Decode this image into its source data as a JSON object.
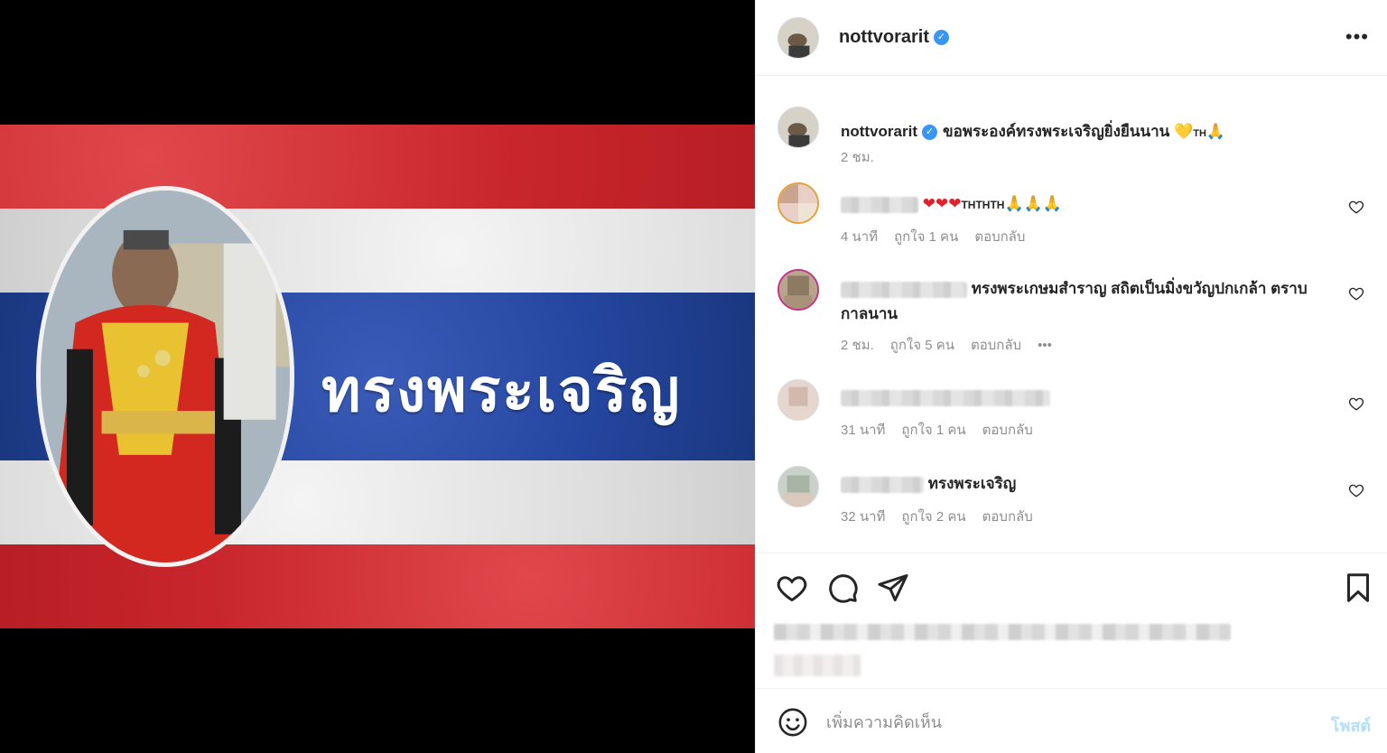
{
  "post": {
    "username": "nottvorarit",
    "headline_text": "ทรงพระเจริญ",
    "caption": "ขอพระองค์ทรงพระเจริญยิ่งยืนนาน",
    "caption_emoji": "💛",
    "caption_flag": "TH",
    "caption_pray": "🙏",
    "caption_time": "2 ชม."
  },
  "comments": [
    {
      "text_emoji": "❤❤❤",
      "flags": "THTHTH",
      "pray": "🙏🙏🙏",
      "time": "4 นาที",
      "likes": "ถูกใจ 1 คน",
      "reply": "ตอบกลับ"
    },
    {
      "text": "ทรงพระเกษมสำราญ สถิตเป็นมิ่งขวัญปกเกล้า ตราบกาลนาน",
      "time": "2 ชม.",
      "likes": "ถูกใจ 5 คน",
      "reply": "ตอบกลับ",
      "more": "•••"
    },
    {
      "time": "31 นาที",
      "likes": "ถูกใจ 1 คน",
      "reply": "ตอบกลับ"
    },
    {
      "text": "ทรงพระเจริญ",
      "time": "32 นาที",
      "likes": "ถูกใจ 2 คน",
      "reply": "ตอบกลับ"
    }
  ],
  "composer": {
    "placeholder": "เพิ่มความคิดเห็น",
    "post_label": "โพสต์"
  },
  "header": {
    "more_label": "•••"
  },
  "colors": {
    "link_blue": "#3897f0",
    "post_disabled": "#b2dffc",
    "flag_red": "#c8262c",
    "flag_blue": "#2546a0",
    "muted": "#8e8e8e"
  }
}
